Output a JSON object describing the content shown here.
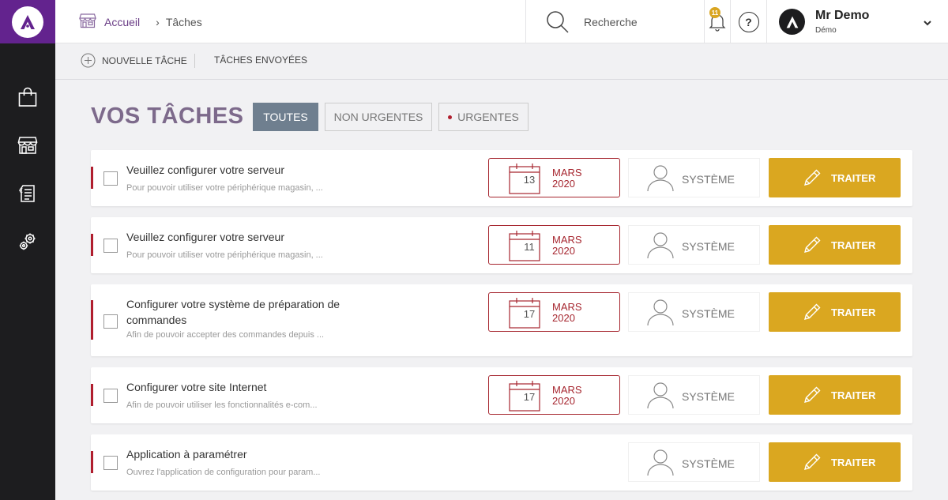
{
  "breadcrumb": {
    "home": "Accueil",
    "separator": "›",
    "current": "Tâches"
  },
  "search": {
    "placeholder": "Recherche"
  },
  "notifications": {
    "count": "11"
  },
  "help": {
    "label": "?"
  },
  "user": {
    "name": "Mr Demo",
    "role": "Démo"
  },
  "toolbar": {
    "new_task": "NOUVELLE TÂCHE",
    "sent_tasks": "TÂCHES ENVOYÉES"
  },
  "page": {
    "title": "VOS TÂCHES"
  },
  "filters": {
    "all": "TOUTES",
    "non_urgent": "NON URGENTES",
    "urgent": "URGENTES"
  },
  "tasks": [
    {
      "title": "Veuillez configurer votre serveur",
      "description": "Pour pouvoir utiliser votre périphérique magasin, ...",
      "day": "13",
      "month": "MARS",
      "year": "2020",
      "assignee": "SYSTÈME",
      "action": "TRAITER"
    },
    {
      "title": "Veuillez configurer votre serveur",
      "description": "Pour pouvoir utiliser votre périphérique magasin, ...",
      "day": "11",
      "month": "MARS",
      "year": "2020",
      "assignee": "SYSTÈME",
      "action": "TRAITER"
    },
    {
      "title": "Configurer votre système de préparation de commandes",
      "description": "Afin de pouvoir accepter des commandes depuis ...",
      "day": "17",
      "month": "MARS",
      "year": "2020",
      "assignee": "SYSTÈME",
      "action": "TRAITER"
    },
    {
      "title": "Configurer votre site Internet",
      "description": "Afin de pouvoir utiliser les fonctionnalités e-com...",
      "day": "17",
      "month": "MARS",
      "year": "2020",
      "assignee": "SYSTÈME",
      "action": "TRAITER"
    },
    {
      "title": "Application à paramétrer",
      "description": "Ouvrez l'application de configuration pour param...",
      "assignee": "SYSTÈME",
      "action": "TRAITER"
    }
  ],
  "colors": {
    "brand": "#63238e",
    "urgent": "#b01e2e",
    "action": "#daa720",
    "sidebar": "#1d1d1f"
  }
}
